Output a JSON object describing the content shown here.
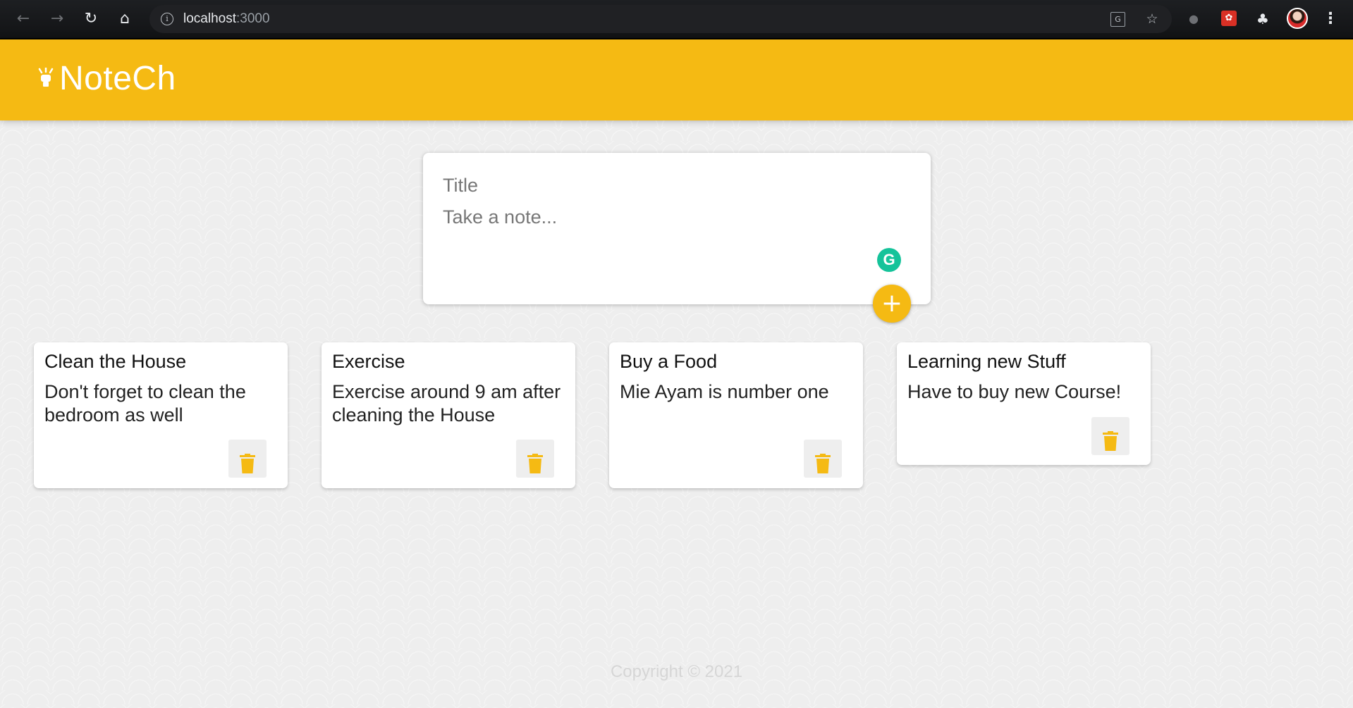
{
  "browser": {
    "url_host": "localhost",
    "url_port": ":3000",
    "icons": [
      "back-icon",
      "forward-icon",
      "reload-icon",
      "home-icon",
      "info-icon",
      "translate-icon",
      "star-icon",
      "extension-icon",
      "puzzle-icon",
      "profile-avatar",
      "menu-icon"
    ]
  },
  "header": {
    "brand": "NoteCh",
    "logo_icon": "lightbulb-icon",
    "color": "#f5ba13"
  },
  "create_area": {
    "title_placeholder": "Title",
    "content_placeholder": "Take a note...",
    "add_label": "+"
  },
  "notes": [
    {
      "title": "Clean the House",
      "content": "Don't forget to clean the bedroom as well"
    },
    {
      "title": "Exercise",
      "content": "Exercise around 9 am after cleaning the House"
    },
    {
      "title": "Buy a Food",
      "content": "Mie Ayam is number one"
    },
    {
      "title": "Learning new Stuff",
      "content": "Have to buy new Course!"
    }
  ],
  "footer": {
    "copyright": "Copyright © 2021"
  },
  "colors": {
    "accent": "#f5ba13",
    "background": "#eeeeee",
    "grammarly": "#15c39a"
  }
}
